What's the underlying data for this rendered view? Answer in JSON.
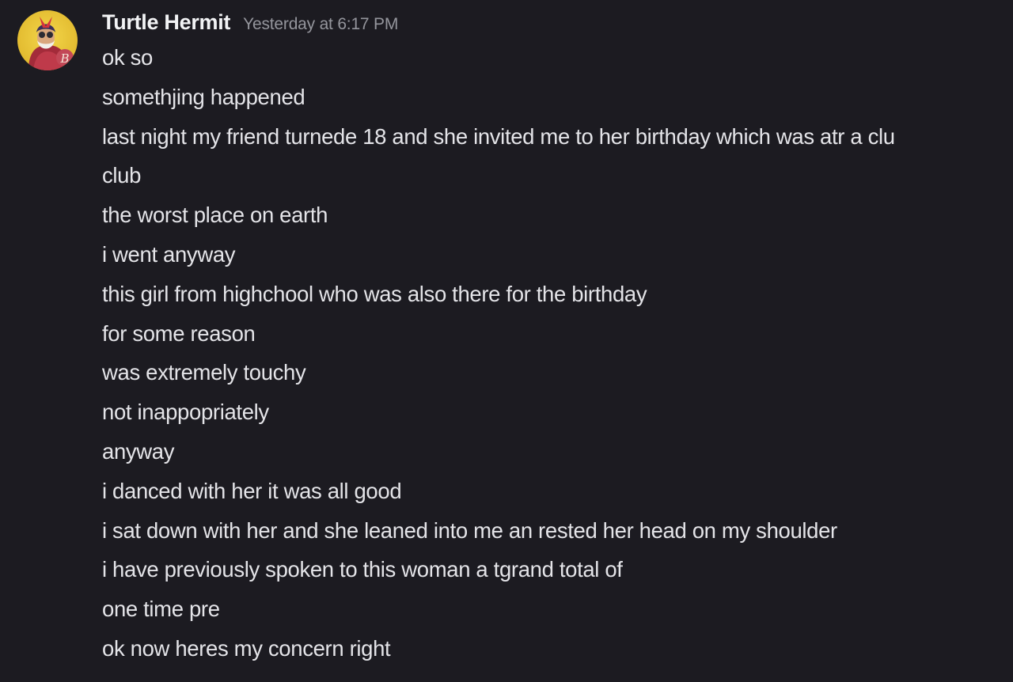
{
  "message": {
    "author": {
      "name": "Turtle Hermit",
      "avatar_icon": "hermit-avatar-icon",
      "avatar_letter": "B"
    },
    "timestamp": "Yesterday at 6:17 PM",
    "lines": [
      "ok so",
      "somethjing happened",
      "last night my friend turnede 18 and she invited me to her birthday which was atr a clu",
      "club",
      "the worst place on earth",
      "i went anyway",
      "this girl from highchool who was also there for the birthday",
      "for some reason",
      "was extremely touchy",
      "not inappopriately",
      "anyway",
      "i danced with her it was all good",
      "i sat down with her and she leaned into me an rested her head on my shoulder",
      "i have previously spoken to this woman a tgrand total of",
      "one time pre",
      "ok now heres my concern right"
    ]
  },
  "colors": {
    "background": "#1c1b21",
    "text": "#e4e4e8",
    "username": "#f2f3f5",
    "timestamp": "#94959c"
  }
}
